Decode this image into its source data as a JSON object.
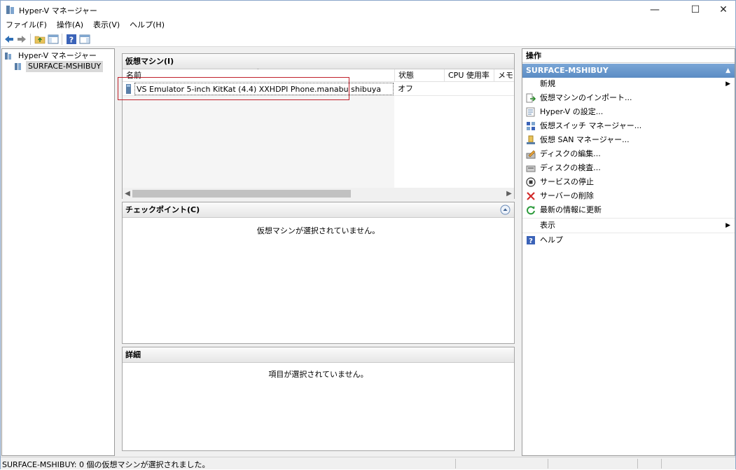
{
  "window": {
    "title": "Hyper-V マネージャー",
    "minimize": "—",
    "maximize": "☐",
    "close": "✕"
  },
  "menu": [
    "ファイル(F)",
    "操作(A)",
    "表示(V)",
    "ヘルプ(H)"
  ],
  "toolbar": {
    "icons": [
      "back-icon",
      "forward-icon",
      "up-folder-icon",
      "show-hide-tree-icon",
      "help-icon",
      "action-pane-icon"
    ]
  },
  "tree": {
    "root": "Hyper-V マネージャー",
    "server": "SURFACE-MSHIBUY"
  },
  "vm_pane": {
    "title": "仮想マシン(I)",
    "columns": [
      "名前",
      "状態",
      "CPU 使用率",
      "メモリ"
    ],
    "rows": [
      {
        "name": "VS Emulator 5-inch KitKat (4.4) XXHDPI Phone.manabu shibuya",
        "state": "オフ",
        "cpu": "",
        "memory": ""
      }
    ]
  },
  "checkpoint_pane": {
    "title": "チェックポイント(C)",
    "message": "仮想マシンが選択されていません。"
  },
  "details_pane": {
    "title": "詳細",
    "message": "項目が選択されていません。"
  },
  "actions": {
    "header": "操作",
    "section": "SURFACE-MSHIBUY",
    "items": [
      {
        "label": "新規",
        "icon": "none",
        "submenu": true
      },
      {
        "label": "仮想マシンのインポート...",
        "icon": "import-icon",
        "submenu": false
      },
      {
        "label": "Hyper-V の設定...",
        "icon": "settings-icon",
        "submenu": false
      },
      {
        "label": "仮想スイッチ マネージャー...",
        "icon": "switch-icon",
        "submenu": false
      },
      {
        "label": "仮想 SAN マネージャー...",
        "icon": "san-icon",
        "submenu": false
      },
      {
        "label": "ディスクの編集...",
        "icon": "edit-disk-icon",
        "submenu": false
      },
      {
        "label": "ディスクの検査...",
        "icon": "inspect-disk-icon",
        "submenu": false
      },
      {
        "label": "サービスの停止",
        "icon": "stop-icon",
        "submenu": false
      },
      {
        "label": "サーバーの削除",
        "icon": "delete-icon",
        "submenu": false
      },
      {
        "label": "最新の情報に更新",
        "icon": "refresh-icon",
        "submenu": false
      },
      {
        "label": "表示",
        "icon": "none",
        "submenu": true
      },
      {
        "label": "ヘルプ",
        "icon": "help-icon",
        "submenu": false
      }
    ]
  },
  "status": {
    "text": "SURFACE-MSHIBUY:  0 個の仮想マシンが選択されました。"
  },
  "colors": {
    "accent": "#5b8cc4",
    "highlight_box": "#c0202a",
    "selected_tree": "#d9d9d9"
  }
}
